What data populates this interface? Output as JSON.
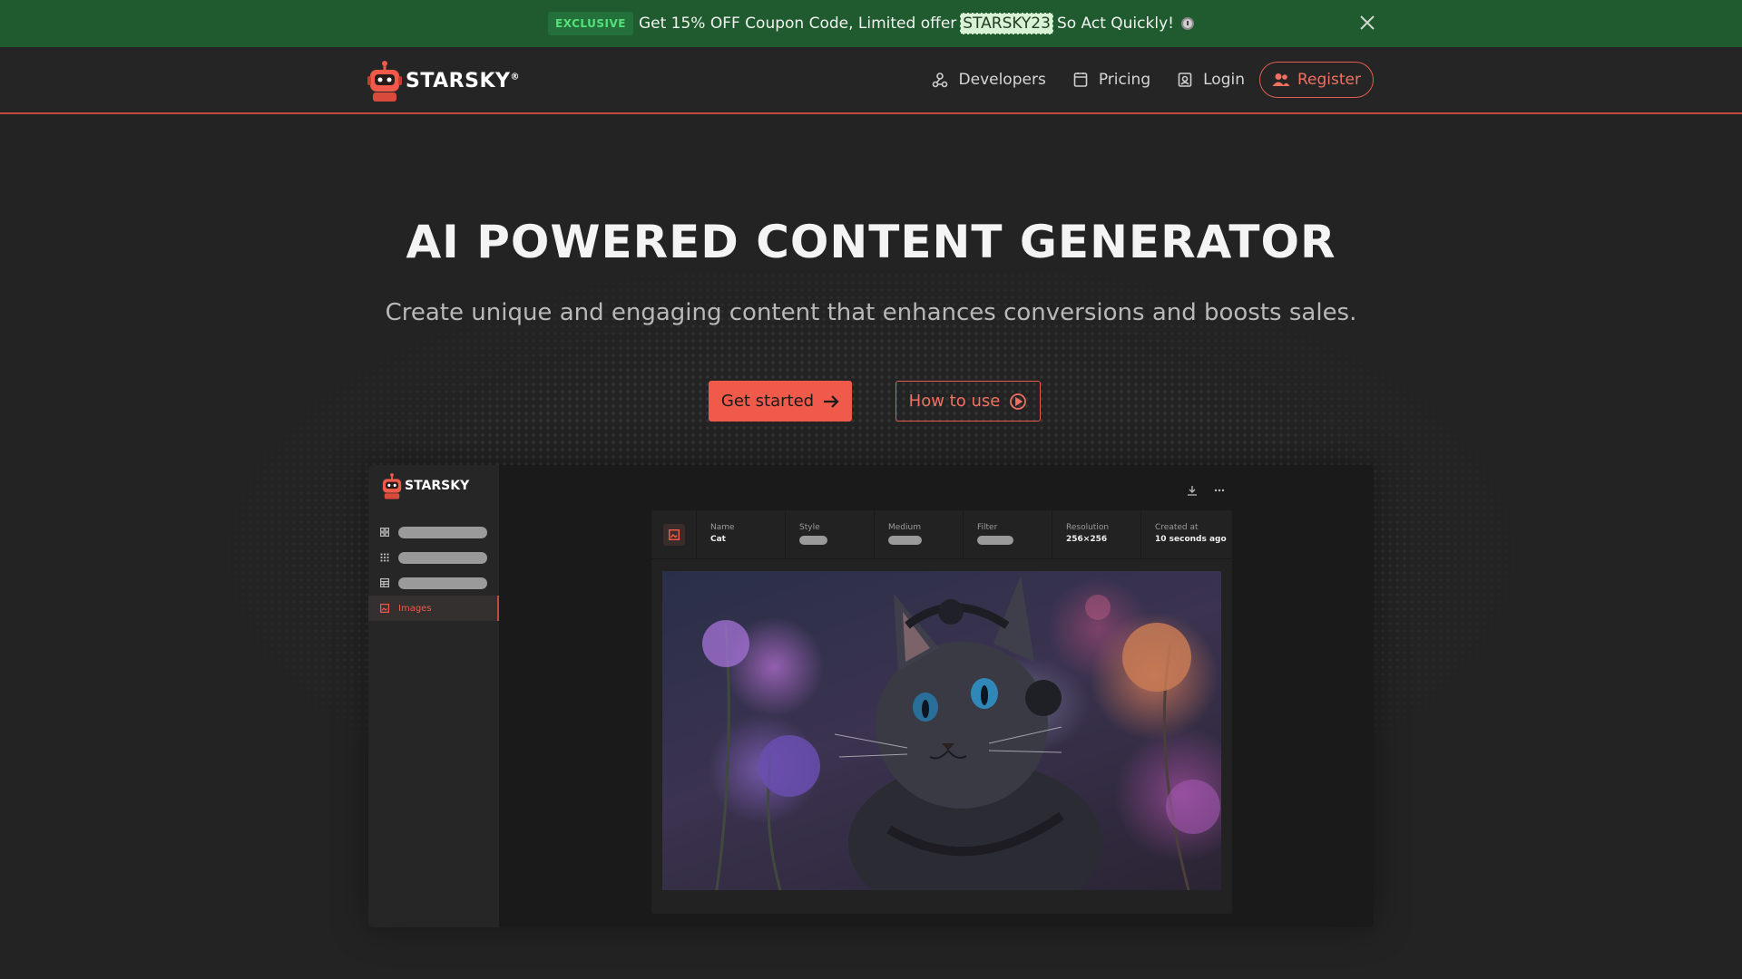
{
  "promo": {
    "badge": "EXCLUSIVE",
    "text_before": "Get 15% OFF Coupon Code, Limited offer",
    "code": "STARSKY23",
    "text_after": "So Act Quickly!"
  },
  "header": {
    "logo_text": "STARSKY",
    "logo_mark": "®",
    "nav": {
      "developers": "Developers",
      "pricing": "Pricing",
      "login": "Login",
      "register": "Register"
    }
  },
  "hero": {
    "title": "AI POWERED CONTENT GENERATOR",
    "subtitle": "Create unique and engaging content that enhances conversions and boosts sales.",
    "primary_button": "Get started",
    "secondary_button": "How to use"
  },
  "preview": {
    "logo_text": "STARSKY",
    "sidebar_active": "Images",
    "meta": {
      "name_label": "Name",
      "name_value": "Cat",
      "style_label": "Style",
      "medium_label": "Medium",
      "filter_label": "Filter",
      "resolution_label": "Resolution",
      "resolution_value": "256×256",
      "created_label": "Created at",
      "created_value": "10 seconds ago"
    }
  },
  "colors": {
    "accent": "#ef5a4a",
    "promo_bg": "#1f5b2e",
    "background": "#232323"
  }
}
